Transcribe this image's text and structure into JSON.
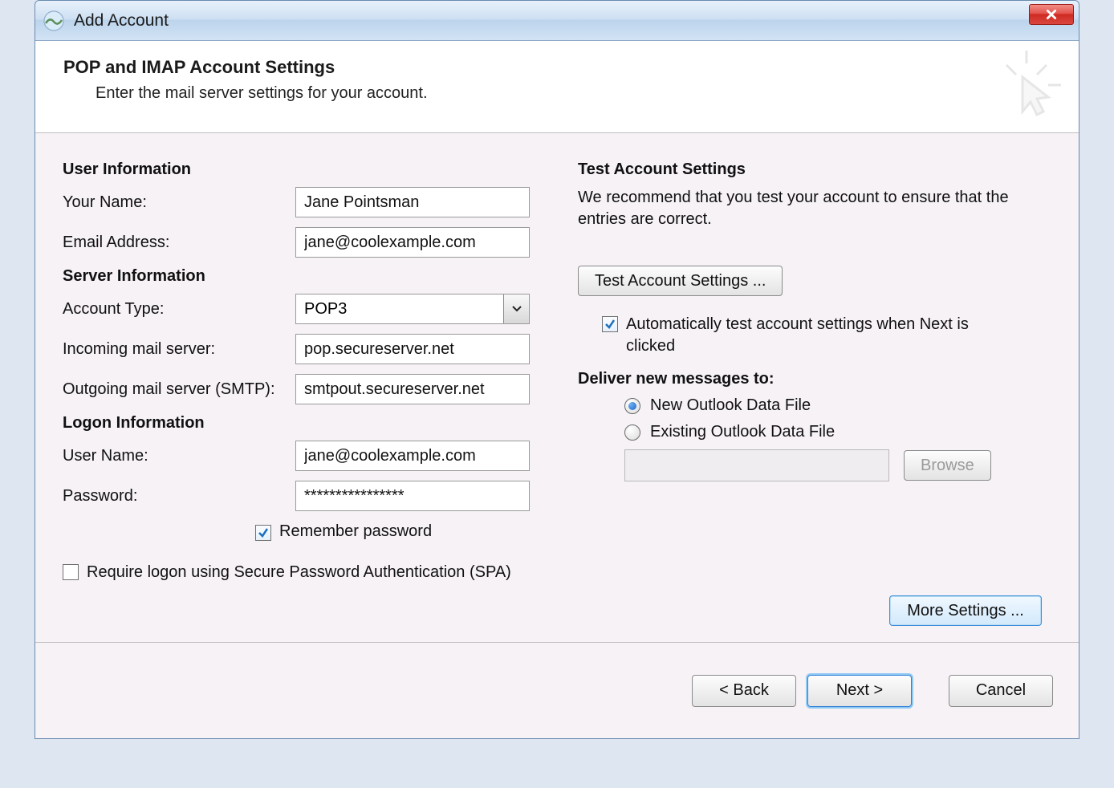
{
  "window": {
    "title": "Add Account"
  },
  "header": {
    "title": "POP and IMAP Account Settings",
    "subtitle": "Enter the mail server settings for your account."
  },
  "sections": {
    "user_info": "User Information",
    "server_info": "Server Information",
    "logon_info": "Logon Information",
    "test_settings": "Test Account Settings",
    "deliver_to": "Deliver new messages to:"
  },
  "labels": {
    "your_name": "Your Name:",
    "email": "Email Address:",
    "account_type": "Account Type:",
    "incoming": "Incoming mail server:",
    "outgoing": "Outgoing mail server (SMTP):",
    "username": "User Name:",
    "password": "Password:",
    "remember_pw": "Remember password",
    "spa": "Require logon using Secure Password Authentication (SPA)",
    "auto_test": "Automatically test account settings when Next is clicked",
    "new_pst": "New Outlook Data File",
    "existing_pst": "Existing Outlook Data File"
  },
  "values": {
    "your_name": "Jane Pointsman",
    "email": "jane@coolexample.com",
    "account_type": "POP3",
    "incoming": "pop.secureserver.net",
    "outgoing": "smtpout.secureserver.net",
    "username": "jane@coolexample.com",
    "password": "****************",
    "remember_pw_checked": true,
    "spa_checked": false,
    "auto_test_checked": true,
    "deliver_selection": "new",
    "existing_path": ""
  },
  "right": {
    "desc": "We recommend that you test your account to ensure that the entries are correct."
  },
  "buttons": {
    "test": "Test Account Settings ...",
    "browse": "Browse",
    "more": "More Settings ...",
    "back": "<  Back",
    "next": "Next  >",
    "cancel": "Cancel"
  }
}
